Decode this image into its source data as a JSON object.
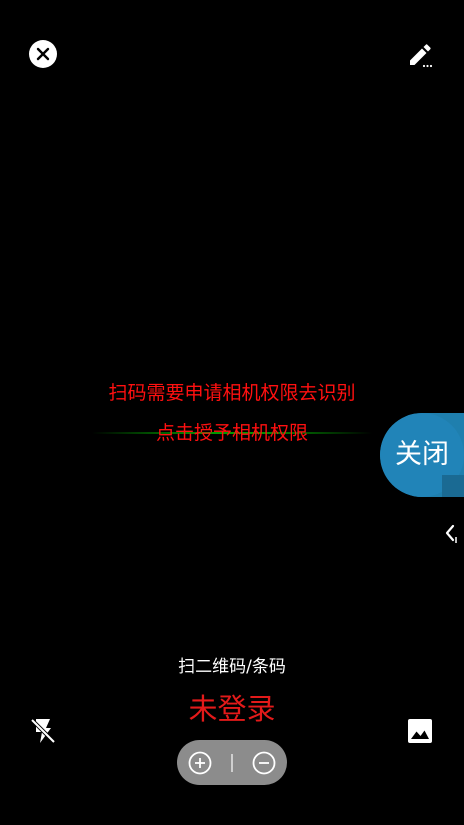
{
  "top_bar": {
    "close_icon": "close-icon",
    "edit_icon": "edit-pencil-icon"
  },
  "permission": {
    "line1": "扫码需要申请相机权限去识别",
    "line2": "点击授予相机权限",
    "color": "#ff1010"
  },
  "float_button": {
    "label": "关闭",
    "color": "#2184b8"
  },
  "side_handle": {
    "icon": "chevron-left-icon"
  },
  "scan_mode": {
    "label": "扫二维码/条码"
  },
  "login_status": {
    "text": "未登录",
    "color": "#e31a1a"
  },
  "bottom_bar": {
    "flash_icon": "flash-off-icon",
    "gallery_icon": "image-icon",
    "zoom_in_icon": "zoom-in-icon",
    "zoom_out_icon": "zoom-out-icon"
  }
}
